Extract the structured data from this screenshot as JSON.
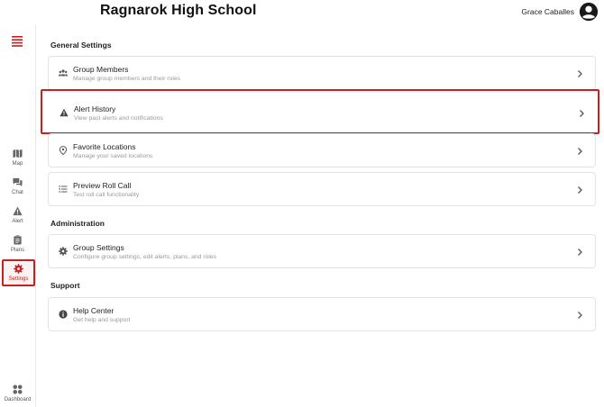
{
  "header": {
    "school_name": "Ragnarok High School",
    "user_name": "Grace Caballes"
  },
  "sidebar": {
    "items": [
      {
        "label": "Map",
        "icon": "map-icon"
      },
      {
        "label": "Chat",
        "icon": "chat-icon"
      },
      {
        "label": "Alert",
        "icon": "alert-icon"
      },
      {
        "label": "Plans",
        "icon": "plans-icon"
      },
      {
        "label": "Settings",
        "icon": "gear-icon",
        "active": true
      },
      {
        "label": "Dashboard",
        "icon": "dashboard-icon"
      }
    ]
  },
  "sections": [
    {
      "title": "General Settings",
      "items": [
        {
          "title": "Group Members",
          "subtitle": "Manage group members and their roles",
          "icon": "people-icon"
        },
        {
          "title": "Alert History",
          "subtitle": "View past alerts and notifications",
          "icon": "warning-icon",
          "highlighted": true
        },
        {
          "title": "Favorite Locations",
          "subtitle": "Manage your saved locations",
          "icon": "location-pin-icon"
        },
        {
          "title": "Preview Roll Call",
          "subtitle": "Test roll call functionality",
          "icon": "checklist-icon"
        }
      ]
    },
    {
      "title": "Administration",
      "items": [
        {
          "title": "Group Settings",
          "subtitle": "Configure group settings, edit alerts, plans, and roles",
          "icon": "gear-icon"
        }
      ]
    },
    {
      "title": "Support",
      "items": [
        {
          "title": "Help Center",
          "subtitle": "Get help and support",
          "icon": "info-icon"
        }
      ]
    }
  ],
  "colors": {
    "accent": "#c8201e",
    "icon_gray": "#666666",
    "subtitle_gray": "#999999"
  }
}
